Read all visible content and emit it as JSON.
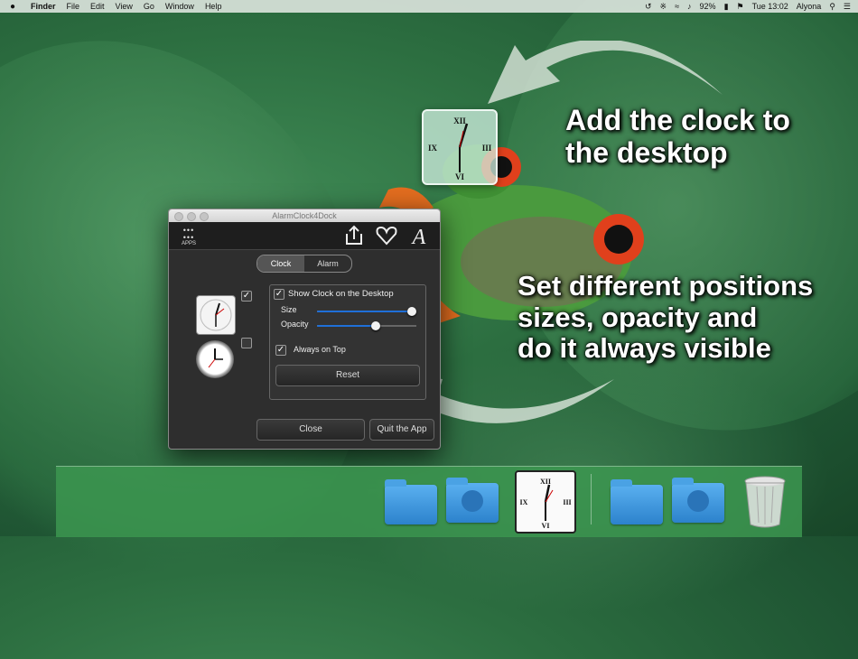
{
  "menubar": {
    "app_name": "Finder",
    "items": [
      "File",
      "Edit",
      "View",
      "Go",
      "Window",
      "Help"
    ],
    "battery": "92%",
    "clock": "Tue 13:02",
    "user": "Alyona"
  },
  "callouts": {
    "desktop": "Add the clock to the desktop",
    "positions_line1": "Set different positions",
    "positions_line2": "sizes, opacity and",
    "positions_line3": "do it always visible"
  },
  "window": {
    "title": "AlarmClock4Dock",
    "apps_label": "APPS",
    "tabs": [
      "Clock",
      "Alarm"
    ],
    "active_tab": "Clock",
    "show_clock_label": "Show Clock on the Desktop",
    "show_clock_checked": true,
    "size_label": "Size",
    "size_value": 0.95,
    "opacity_label": "Opacity",
    "opacity_value": 0.59,
    "always_on_top_label": "Always on Top",
    "always_on_top_checked": true,
    "reset_label": "Reset",
    "close_label": "Close",
    "quit_label": "Quit the App",
    "clock_style1_checked": true,
    "clock_style2_checked": false
  },
  "colors": {
    "accent": "#1f6fd8",
    "dock": "#3c9650"
  }
}
